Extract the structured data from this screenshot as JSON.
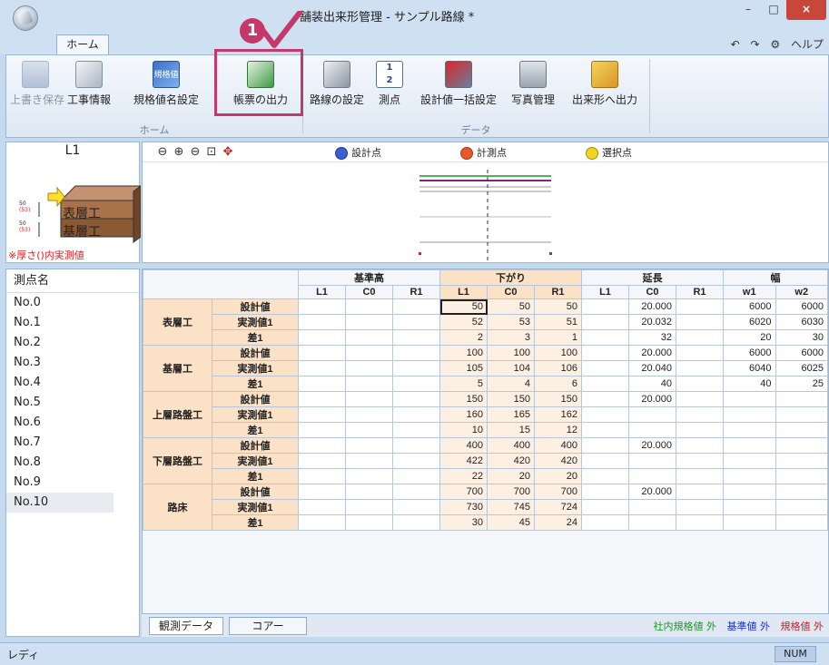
{
  "window": {
    "title": "舗装出来形管理 - サンプル路線 *",
    "min": "–",
    "max": "□",
    "close": "×"
  },
  "tabs": {
    "home": "ホーム"
  },
  "quick_access": {
    "undo": "↶",
    "redo": "↷",
    "help": "ヘルプ"
  },
  "ribbon": {
    "buttons": [
      {
        "label": "上書き保存",
        "icon": "save-icon"
      },
      {
        "label": "工事情報",
        "icon": "construction-info-icon"
      },
      {
        "label": "規格値名設定",
        "icon": "spec-name-icon"
      },
      {
        "label": "帳票の出力",
        "icon": "report-output-icon"
      },
      {
        "label": "路線の設定",
        "icon": "route-settings-icon"
      },
      {
        "label": "測点",
        "icon": "survey-point-icon"
      },
      {
        "label": "設計値一括設定",
        "icon": "batch-design-icon"
      },
      {
        "label": "写真管理",
        "icon": "photo-icon"
      },
      {
        "label": "出来形へ出力",
        "icon": "export-icon"
      }
    ],
    "group_home": "ホーム",
    "group_data": "データ",
    "spec_icon_text": "規格値"
  },
  "annotation": {
    "step": "1"
  },
  "left_panel": {
    "section_label": "L1",
    "layer_top": "表層工",
    "layer_bottom": "基層工",
    "thk_top": "50",
    "thk_top_meas": "(53)",
    "thk_bot": "50",
    "thk_bot_meas": "(53)",
    "note": "※厚さ()内実測値"
  },
  "points": {
    "header": "測点名",
    "items": [
      "No.0",
      "No.1",
      "No.2",
      "No.3",
      "No.4",
      "No.5",
      "No.6",
      "No.7",
      "No.8",
      "No.9",
      "No.10"
    ],
    "selected_index": 10
  },
  "preview": {
    "legend": [
      {
        "label": "設計点",
        "color": "#3a5fd0"
      },
      {
        "label": "計測点",
        "color": "#e8582c"
      },
      {
        "label": "選択点",
        "color": "#f2d422"
      }
    ]
  },
  "grid": {
    "groups": [
      "基準高",
      "下がり",
      "延長",
      "幅"
    ],
    "sub_headers": [
      "L1",
      "C0",
      "R1",
      "L1",
      "C0",
      "R1",
      "L1",
      "C0",
      "R1",
      "w1",
      "w2"
    ],
    "layers": [
      {
        "name": "表層工",
        "rows": [
          {
            "label": "設計値",
            "cells": [
              "",
              "",
              "",
              "50",
              "50",
              "50",
              "",
              "20.000",
              "",
              "6000",
              "6000"
            ]
          },
          {
            "label": "実測値1",
            "cells": [
              "",
              "",
              "",
              "52",
              "53",
              "51",
              "",
              "20.032",
              "",
              "6020",
              "6030"
            ]
          },
          {
            "label": "差1",
            "cells": [
              "",
              "",
              "",
              "2",
              "3",
              "1",
              "",
              "32",
              "",
              "20",
              "30"
            ]
          }
        ]
      },
      {
        "name": "基層工",
        "rows": [
          {
            "label": "設計値",
            "cells": [
              "",
              "",
              "",
              "100",
              "100",
              "100",
              "",
              "20.000",
              "",
              "6000",
              "6000"
            ]
          },
          {
            "label": "実測値1",
            "cells": [
              "",
              "",
              "",
              "105",
              "104",
              "106",
              "",
              "20.040",
              "",
              "6040",
              "6025"
            ]
          },
          {
            "label": "差1",
            "cells": [
              "",
              "",
              "",
              "5",
              "4",
              "6",
              "",
              "40",
              "",
              "40",
              "25"
            ]
          }
        ]
      },
      {
        "name": "上層路盤工",
        "rows": [
          {
            "label": "設計値",
            "cells": [
              "",
              "",
              "",
              "150",
              "150",
              "150",
              "",
              "20.000",
              "",
              "",
              ""
            ]
          },
          {
            "label": "実測値1",
            "cells": [
              "",
              "",
              "",
              "160",
              "165",
              "162",
              "",
              "",
              "",
              "",
              ""
            ]
          },
          {
            "label": "差1",
            "cells": [
              "",
              "",
              "",
              "10",
              "15",
              "12",
              "",
              "",
              "",
              "",
              ""
            ]
          }
        ]
      },
      {
        "name": "下層路盤工",
        "rows": [
          {
            "label": "設計値",
            "cells": [
              "",
              "",
              "",
              "400",
              "400",
              "400",
              "",
              "20.000",
              "",
              "",
              ""
            ]
          },
          {
            "label": "実測値1",
            "cells": [
              "",
              "",
              "",
              "422",
              "420",
              "420",
              "",
              "",
              "",
              "",
              ""
            ]
          },
          {
            "label": "差1",
            "cells": [
              "",
              "",
              "",
              "22",
              "20",
              "20",
              "",
              "",
              "",
              "",
              ""
            ]
          }
        ]
      },
      {
        "name": "路床",
        "rows": [
          {
            "label": "設計値",
            "cells": [
              "",
              "",
              "",
              "700",
              "700",
              "700",
              "",
              "20.000",
              "",
              "",
              ""
            ]
          },
          {
            "label": "実測値1",
            "cells": [
              "",
              "",
              "",
              "730",
              "745",
              "724",
              "",
              "",
              "",
              "",
              ""
            ]
          },
          {
            "label": "差1",
            "cells": [
              "",
              "",
              "",
              "30",
              "45",
              "24",
              "",
              "",
              "",
              "",
              ""
            ]
          }
        ]
      }
    ]
  },
  "bottom_tabs": {
    "observation": "観測データ",
    "core": "コアー"
  },
  "bottom_legend": [
    {
      "text": "社内規格値 外",
      "color": "#1a9a1a"
    },
    {
      "text": "基準値 外",
      "color": "#1c2fd6"
    },
    {
      "text": "規格値 外",
      "color": "#d61c1c"
    }
  ],
  "status": {
    "text": "レディ",
    "num": "NUM"
  }
}
